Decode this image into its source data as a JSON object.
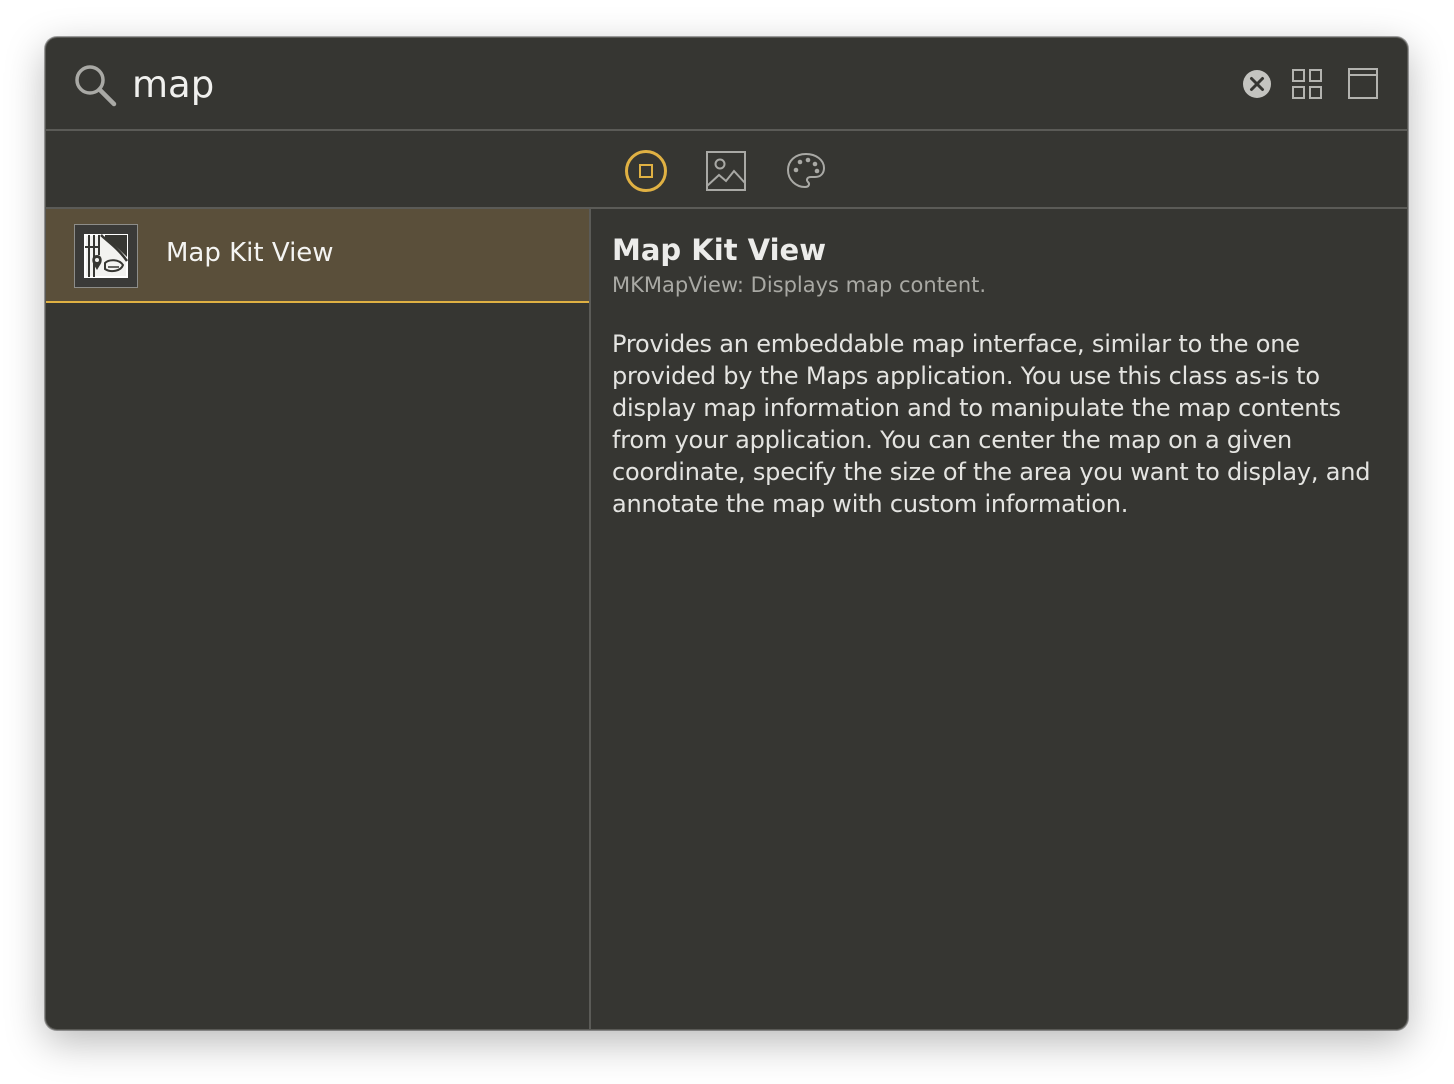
{
  "search": {
    "value": "map",
    "icon": "search-icon"
  },
  "toolbar": {
    "icons": [
      "clear-icon",
      "grid-view-icon",
      "panel-toggle-icon"
    ]
  },
  "filters": {
    "items": [
      {
        "icon": "objects-library-icon",
        "selected": true
      },
      {
        "icon": "media-library-icon",
        "selected": false
      },
      {
        "icon": "color-palette-icon",
        "selected": false
      }
    ],
    "accent": "#e0b143"
  },
  "results": {
    "items": [
      {
        "label": "Map Kit View",
        "icon": "map-kit-view-icon",
        "selected": true
      }
    ]
  },
  "detail": {
    "title": "Map Kit View",
    "subtitle": "MKMapView: Displays map content.",
    "body": "Provides an embeddable map interface, similar to the one provided by the Maps application. You use this class as-is to display map information and to manipulate the map contents from your application. You can center the map on a given coordinate, specify the size of the area you want to display, and annotate the map with custom information."
  },
  "colors": {
    "background": "#363632",
    "selection": "#5a4f3a",
    "divider": "#5b5b57"
  }
}
